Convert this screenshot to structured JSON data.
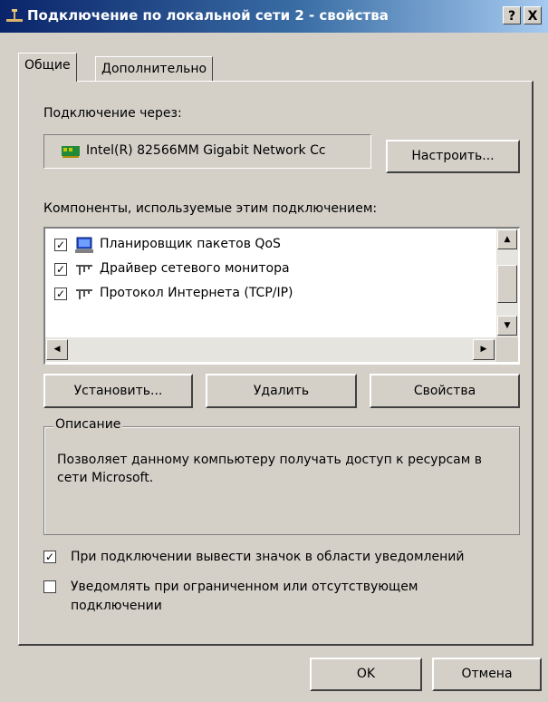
{
  "window": {
    "title": "Подключение по локальной сети 2 - свойства",
    "help_button": "?",
    "close_button": "X"
  },
  "tabs": [
    {
      "label": "Общие",
      "active": true
    },
    {
      "label": "Дополнительно",
      "active": false
    }
  ],
  "connect_using": {
    "label": "Подключение через:",
    "adapter_name": "Intel(R) 82566MM Gigabit Network Cc",
    "configure_button": "Настроить..."
  },
  "components": {
    "label": "Компоненты, используемые этим подключением:",
    "items": [
      {
        "label": "Планировщик пакетов QoS",
        "checked": true,
        "icon": "qos-scheduler-icon"
      },
      {
        "label": "Драйвер сетевого монитора",
        "checked": true,
        "icon": "network-protocol-icon"
      },
      {
        "label": "Протокол Интернета (TCP/IP)",
        "checked": true,
        "icon": "network-protocol-icon"
      }
    ]
  },
  "buttons": {
    "install": "Установить...",
    "remove": "Удалить",
    "properties": "Свойства",
    "ok": "OK",
    "cancel": "Отмена"
  },
  "description": {
    "title": "Описание",
    "text": "Позволяет данному компьютеру получать доступ к ресурсам в сети Microsoft."
  },
  "options": [
    {
      "label": "При подключении вывести значок в области уведомлений",
      "checked": true
    },
    {
      "label": "Уведомлять при ограниченном или отсутствующем подключении",
      "checked": false
    }
  ],
  "colors": {
    "title_bar_start": "#0a246a",
    "title_bar_end": "#a6caf0",
    "dialog_bg": "#d4d0c8"
  }
}
